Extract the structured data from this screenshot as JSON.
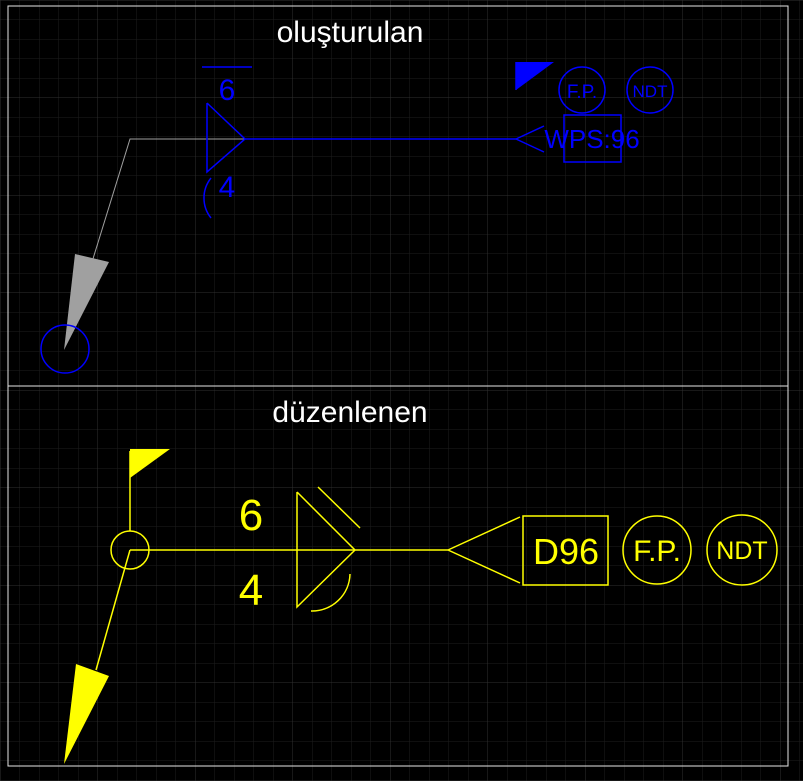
{
  "panels": {
    "top": {
      "title": "oluşturulan",
      "symbol": {
        "arrow_side_size": "6",
        "other_side_size": "4",
        "tail_reference": "WPS:96",
        "circle_1": "F.P.",
        "circle_2": "NDT"
      },
      "color": "#0000ff",
      "leader_color": "#a0a0a0"
    },
    "bottom": {
      "title": "düzenlenen",
      "symbol": {
        "arrow_side_size": "6",
        "other_side_size": "4",
        "tail_reference": "D96",
        "circle_1": "F.P.",
        "circle_2": "NDT"
      },
      "color": "#ffff00"
    }
  },
  "colors": {
    "background": "#000000",
    "grid_minor": "#1e1e1e",
    "grid_major": "#303030",
    "frame": "#e6e6e6",
    "title": "#ffffff"
  }
}
